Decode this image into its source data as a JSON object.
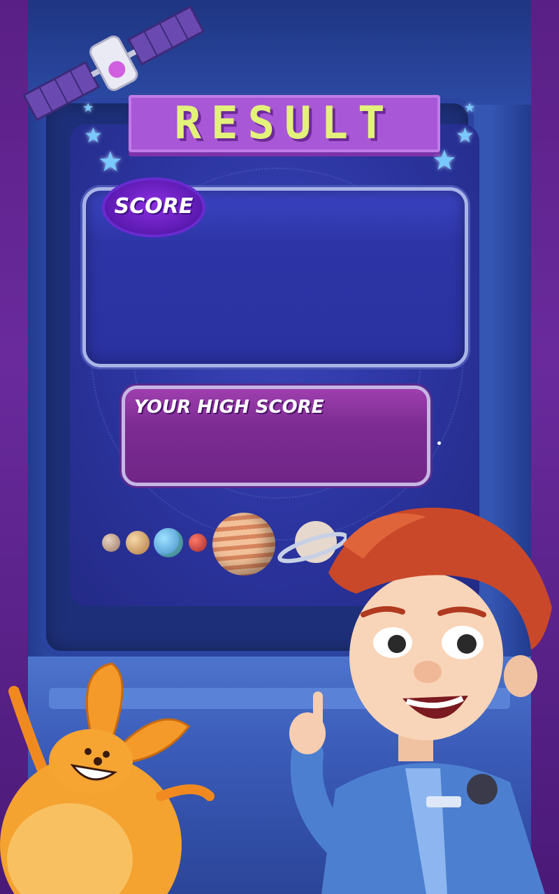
{
  "title": "RESULT",
  "score": {
    "label": "SCORE",
    "value": ""
  },
  "high_score": {
    "label": "YOUR HIGH SCORE",
    "value": ""
  },
  "icons": [
    "satellite-icon",
    "star-icon",
    "planet-icon",
    "boy-character",
    "alien-character"
  ],
  "colors": {
    "title_fill": "#e3f27a",
    "title_bg": "#a857d6",
    "score_panel": "#2d35a6",
    "high_score_panel": "#7c2b92"
  }
}
